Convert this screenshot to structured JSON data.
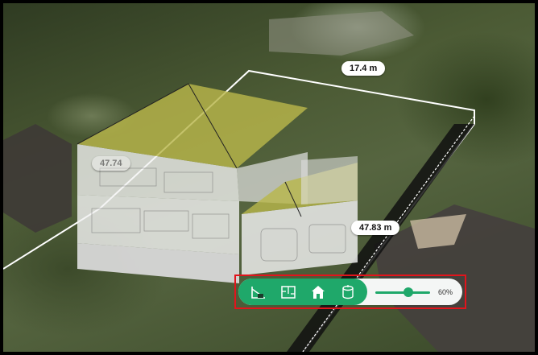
{
  "measurements": {
    "top_edge": "17.4 m",
    "side_edge": "47.83 m",
    "hidden_edge": "47.74"
  },
  "toolbar": {
    "tools": [
      {
        "name": "slope-tool",
        "icon": "roof-slope-icon"
      },
      {
        "name": "floor-plan-tool",
        "icon": "floor-plan-icon"
      },
      {
        "name": "house-view-tool",
        "icon": "house-icon"
      },
      {
        "name": "building-volume-tool",
        "icon": "cylinder-icon"
      }
    ],
    "opacity_label": "60%",
    "opacity_value": 0.6
  },
  "colors": {
    "accent": "#1fa86a",
    "highlight_border": "#e2141c",
    "roof": "#b8b64a"
  }
}
